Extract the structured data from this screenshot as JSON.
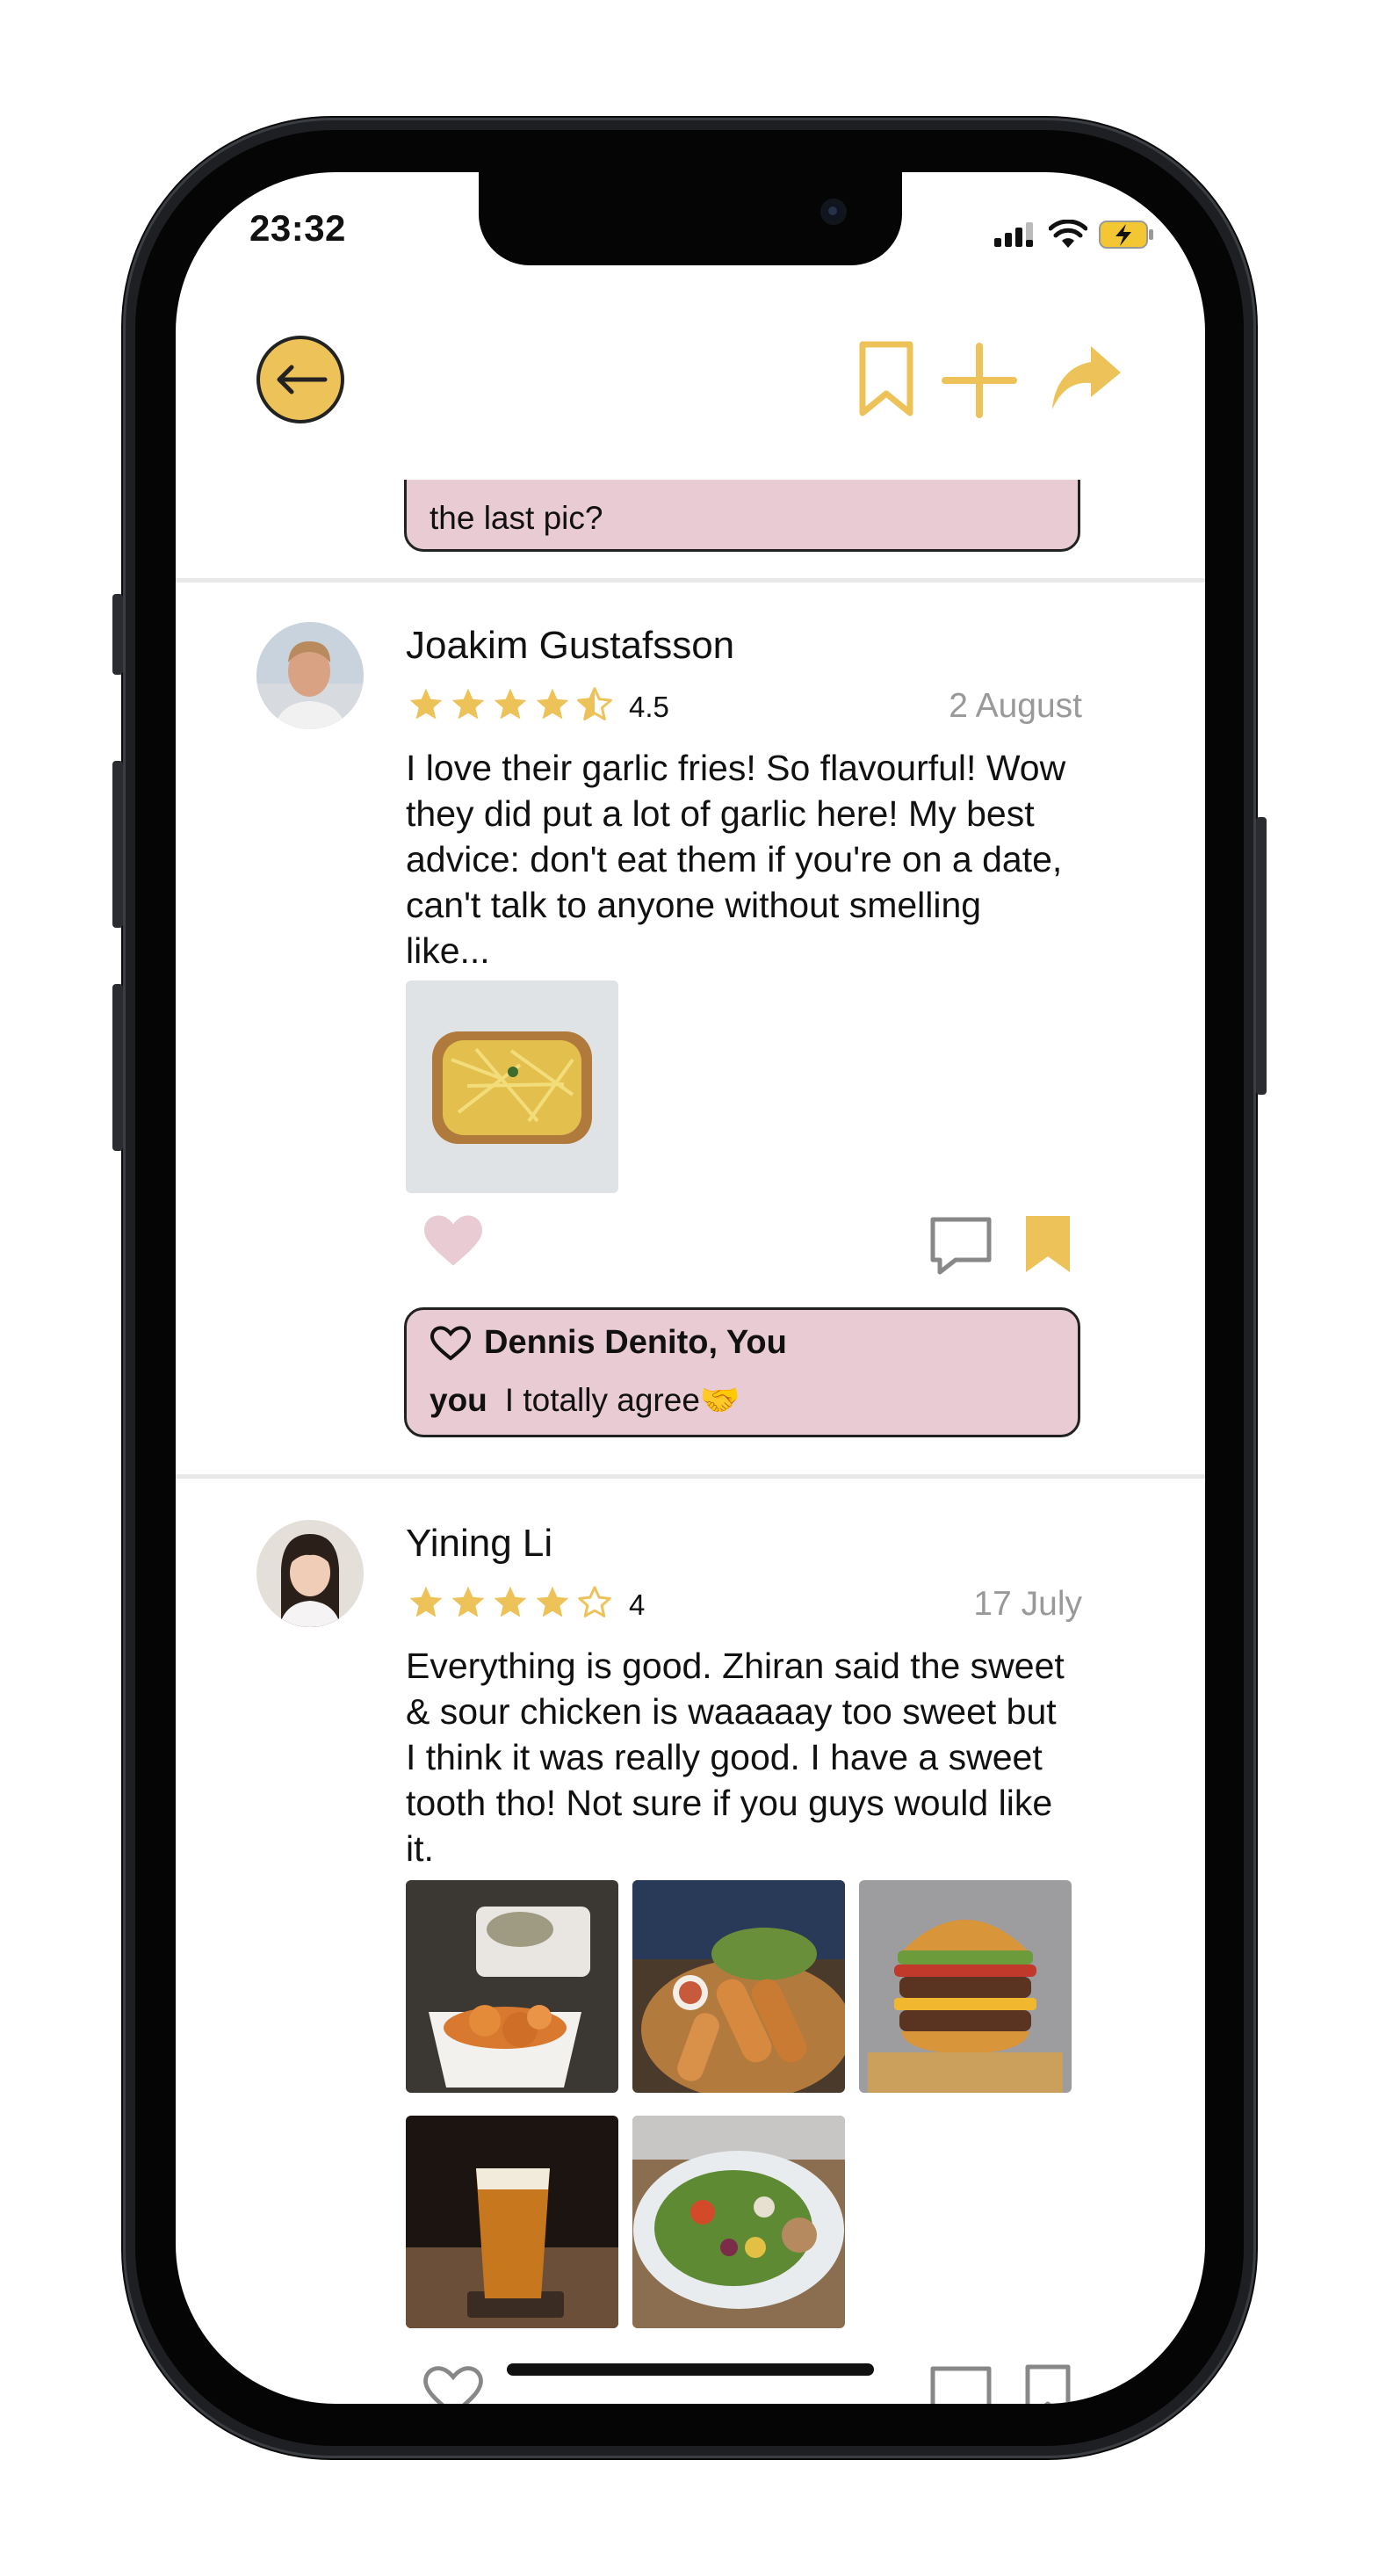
{
  "status_bar": {
    "time": "23:32"
  },
  "header": {
    "icons": [
      "back-arrow-icon",
      "bookmark-icon",
      "plus-icon",
      "share-icon"
    ],
    "accent_color": "#ecc259"
  },
  "previous_comment": {
    "text": "the last pic?"
  },
  "reviews": [
    {
      "name": "Joakim Gustafsson",
      "rating": "4.5",
      "rating_value": 4.5,
      "date": "2 August",
      "text": "I love their garlic fries! So flavourful! Wow they did put a lot of garlic here! My best advice: don't eat them if you're on a date, can't talk to anyone without smelling like...",
      "liked": true,
      "bookmarked": true,
      "likes_by": "Dennis Denito, You",
      "comment": {
        "author": "you",
        "text": "I totally agree🤝"
      }
    },
    {
      "name": "Yining Li",
      "rating": "4",
      "rating_value": 4,
      "date": "17 July",
      "text": "Everything is good. Zhiran said the sweet & sour chicken is waaaaay too sweet but I think it was really good. I have a sweet tooth tho! Not sure if you guys would like it.",
      "liked": false,
      "bookmarked": false
    }
  ],
  "colors": {
    "star": "#ecc259",
    "liked_heart": "#e9cbd4",
    "bubble": "#e9cbd4",
    "muted_text": "#999999"
  }
}
